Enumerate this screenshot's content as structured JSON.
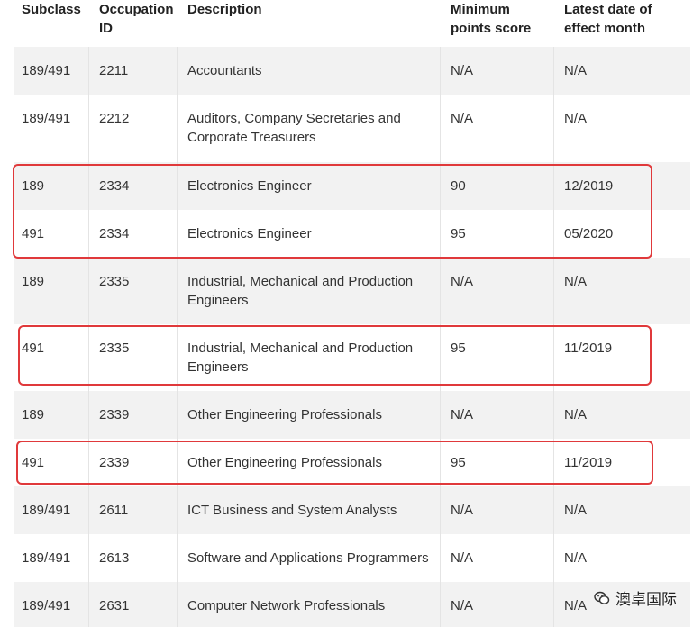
{
  "table": {
    "headers": [
      "Subclass",
      "Occupation ID",
      "Description",
      "Minimum points score",
      "Latest date of effect month"
    ],
    "rows": [
      {
        "subclass": "189/491",
        "occupation_id": "2211",
        "description": "Accountants",
        "min_points": "N/A",
        "latest_date": "N/A"
      },
      {
        "subclass": "189/491",
        "occupation_id": "2212",
        "description": "Auditors, Company Secretaries and Corporate Treasurers",
        "min_points": "N/A",
        "latest_date": "N/A"
      },
      {
        "subclass": "189",
        "occupation_id": "2334",
        "description": "Electronics Engineer",
        "min_points": "90",
        "latest_date": "12/2019"
      },
      {
        "subclass": "491",
        "occupation_id": "2334",
        "description": "Electronics Engineer",
        "min_points": "95",
        "latest_date": "05/2020"
      },
      {
        "subclass": "189",
        "occupation_id": "2335",
        "description": "Industrial, Mechanical and Production Engineers",
        "min_points": "N/A",
        "latest_date": "N/A"
      },
      {
        "subclass": "491",
        "occupation_id": "2335",
        "description": "Industrial, Mechanical and Production Engineers",
        "min_points": "95",
        "latest_date": "11/2019"
      },
      {
        "subclass": "189",
        "occupation_id": "2339",
        "description": "Other Engineering Professionals",
        "min_points": "N/A",
        "latest_date": "N/A"
      },
      {
        "subclass": "491",
        "occupation_id": "2339",
        "description": "Other Engineering Professionals",
        "min_points": "95",
        "latest_date": "11/2019"
      },
      {
        "subclass": "189/491",
        "occupation_id": "2611",
        "description": "ICT Business and System Analysts",
        "min_points": "N/A",
        "latest_date": "N/A"
      },
      {
        "subclass": "189/491",
        "occupation_id": "2613",
        "description": "Software and Applications Programmers",
        "min_points": "N/A",
        "latest_date": "N/A"
      },
      {
        "subclass": "189/491",
        "occupation_id": "2631",
        "description": "Computer Network Professionals",
        "min_points": "N/A",
        "latest_date": "N/A"
      }
    ]
  },
  "brand": {
    "name": "澳卓国际",
    "icon": "wechat-icon"
  },
  "colors": {
    "highlight": "#e0393b",
    "shaded_row": "#f2f2f2"
  }
}
